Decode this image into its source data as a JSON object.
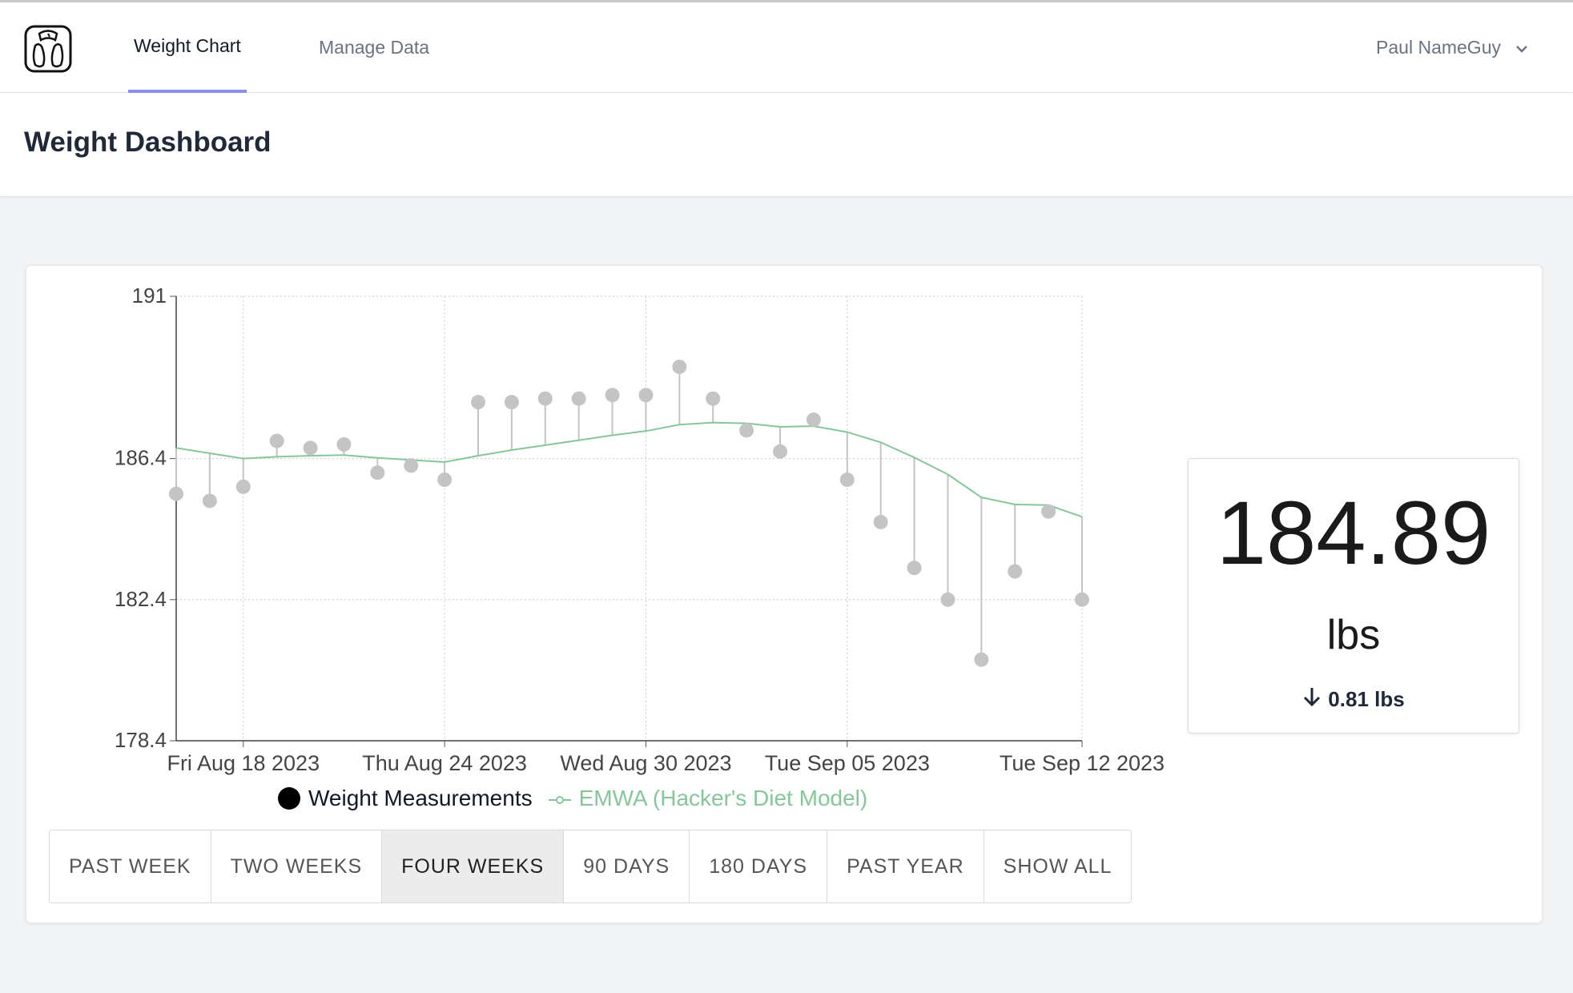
{
  "nav": {
    "logo_icon": "scale-icon",
    "tabs": [
      {
        "label": "Weight Chart",
        "active": true
      },
      {
        "label": "Manage Data",
        "active": false
      }
    ],
    "user": {
      "name": "Paul NameGuy",
      "icon": "chevron-down-icon"
    }
  },
  "header": {
    "title": "Weight Dashboard"
  },
  "ranges": [
    "PAST WEEK",
    "TWO WEEKS",
    "FOUR WEEKS",
    "90 DAYS",
    "180 DAYS",
    "PAST YEAR",
    "SHOW ALL"
  ],
  "selected_range": "FOUR WEEKS",
  "stats": {
    "current": "184.89",
    "unit": "lbs",
    "change": "0.81 lbs",
    "change_icon": "arrow-down-icon"
  },
  "colors": {
    "accent": "#8b8ef0",
    "measurement": "#c4c4c4",
    "ema": "#86c79a"
  },
  "chart_data": {
    "type": "scatter",
    "title": "",
    "xlabel": "",
    "ylabel": "",
    "ylim": [
      178.4,
      191
    ],
    "yticks": [
      "191",
      "186.4",
      "182.4",
      "178.4"
    ],
    "x_ticks": [
      {
        "day": "2023-08-18",
        "label": "Fri Aug 18 2023"
      },
      {
        "day": "2023-08-24",
        "label": "Thu Aug 24 2023"
      },
      {
        "day": "2023-08-30",
        "label": "Wed Aug 30 2023"
      },
      {
        "day": "2023-09-05",
        "label": "Tue Sep 05 2023"
      },
      {
        "day": "2023-09-12",
        "label": "Tue Sep 12 2023"
      }
    ],
    "legend": [
      "Weight Measurements",
      "EMWA (Hacker's Diet Model)"
    ],
    "series": [
      {
        "name": "Weight Measurements",
        "points": [
          {
            "date": "2023-08-16",
            "weight": 185.4
          },
          {
            "date": "2023-08-17",
            "weight": 185.2
          },
          {
            "date": "2023-08-18",
            "weight": 185.6
          },
          {
            "date": "2023-08-19",
            "weight": 186.9
          },
          {
            "date": "2023-08-20",
            "weight": 186.7
          },
          {
            "date": "2023-08-21",
            "weight": 186.8
          },
          {
            "date": "2023-08-22",
            "weight": 186.0
          },
          {
            "date": "2023-08-23",
            "weight": 186.2
          },
          {
            "date": "2023-08-24",
            "weight": 185.8
          },
          {
            "date": "2023-08-25",
            "weight": 188.0
          },
          {
            "date": "2023-08-26",
            "weight": 188.0
          },
          {
            "date": "2023-08-27",
            "weight": 188.1
          },
          {
            "date": "2023-08-28",
            "weight": 188.1
          },
          {
            "date": "2023-08-29",
            "weight": 188.2
          },
          {
            "date": "2023-08-30",
            "weight": 188.2
          },
          {
            "date": "2023-08-31",
            "weight": 189.0
          },
          {
            "date": "2023-09-01",
            "weight": 188.1
          },
          {
            "date": "2023-09-02",
            "weight": 187.2
          },
          {
            "date": "2023-09-03",
            "weight": 186.6
          },
          {
            "date": "2023-09-04",
            "weight": 187.5
          },
          {
            "date": "2023-09-05",
            "weight": 185.8
          },
          {
            "date": "2023-09-06",
            "weight": 184.6
          },
          {
            "date": "2023-09-07",
            "weight": 183.3
          },
          {
            "date": "2023-09-08",
            "weight": 182.4
          },
          {
            "date": "2023-09-09",
            "weight": 180.7
          },
          {
            "date": "2023-09-10",
            "weight": 183.2
          },
          {
            "date": "2023-09-11",
            "weight": 184.9
          },
          {
            "date": "2023-09-12",
            "weight": 182.4
          }
        ]
      },
      {
        "name": "EMWA (Hacker's Diet Model)",
        "points": [
          {
            "date": "2023-08-16",
            "weight": 186.7
          },
          {
            "date": "2023-08-17",
            "weight": 186.55
          },
          {
            "date": "2023-08-18",
            "weight": 186.4
          },
          {
            "date": "2023-08-19",
            "weight": 186.45
          },
          {
            "date": "2023-08-20",
            "weight": 186.48
          },
          {
            "date": "2023-08-21",
            "weight": 186.5
          },
          {
            "date": "2023-08-22",
            "weight": 186.42
          },
          {
            "date": "2023-08-23",
            "weight": 186.36
          },
          {
            "date": "2023-08-24",
            "weight": 186.3
          },
          {
            "date": "2023-08-25",
            "weight": 186.48
          },
          {
            "date": "2023-08-26",
            "weight": 186.64
          },
          {
            "date": "2023-08-27",
            "weight": 186.78
          },
          {
            "date": "2023-08-28",
            "weight": 186.92
          },
          {
            "date": "2023-08-29",
            "weight": 187.06
          },
          {
            "date": "2023-08-30",
            "weight": 187.18
          },
          {
            "date": "2023-08-31",
            "weight": 187.36
          },
          {
            "date": "2023-09-01",
            "weight": 187.42
          },
          {
            "date": "2023-09-02",
            "weight": 187.4
          },
          {
            "date": "2023-09-03",
            "weight": 187.3
          },
          {
            "date": "2023-09-04",
            "weight": 187.32
          },
          {
            "date": "2023-09-05",
            "weight": 187.15
          },
          {
            "date": "2023-09-06",
            "weight": 186.86
          },
          {
            "date": "2023-09-07",
            "weight": 186.43
          },
          {
            "date": "2023-09-08",
            "weight": 185.95
          },
          {
            "date": "2023-09-09",
            "weight": 185.3
          },
          {
            "date": "2023-09-10",
            "weight": 185.1
          },
          {
            "date": "2023-09-11",
            "weight": 185.08
          },
          {
            "date": "2023-09-12",
            "weight": 184.75
          }
        ]
      }
    ]
  }
}
